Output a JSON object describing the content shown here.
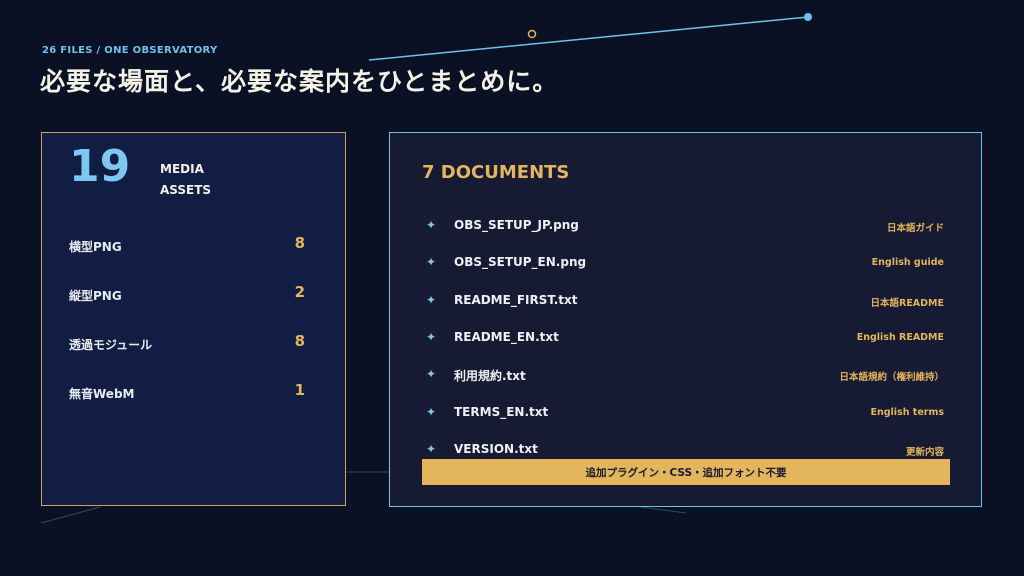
{
  "header": {
    "eyebrow": "26 FILES / ONE OBSERVATORY",
    "headline": "必要な場面と、必要な案内をひとまとめに。"
  },
  "media": {
    "count": "19",
    "label_line1": "MEDIA",
    "label_line2": "ASSETS",
    "items": [
      {
        "label": "横型PNG",
        "value": "8"
      },
      {
        "label": "縦型PNG",
        "value": "2"
      },
      {
        "label": "透過モジュール",
        "value": "8"
      },
      {
        "label": "無音WebM",
        "value": "1"
      }
    ]
  },
  "documents": {
    "title": "7 DOCUMENTS",
    "items": [
      {
        "file": "OBS_SETUP_JP.png",
        "desc": "日本語ガイド"
      },
      {
        "file": "OBS_SETUP_EN.png",
        "desc": "English guide"
      },
      {
        "file": "README_FIRST.txt",
        "desc": "日本語README"
      },
      {
        "file": "README_EN.txt",
        "desc": "English README"
      },
      {
        "file": "利用規約.txt",
        "desc": "日本語規約（権利維持）"
      },
      {
        "file": "TERMS_EN.txt",
        "desc": "English terms"
      },
      {
        "file": "VERSION.txt",
        "desc": "更新内容"
      }
    ],
    "bullet_icon": "four-point-star-icon",
    "banner": "追加プラグイン・CSS・追加フォント不要"
  },
  "colors": {
    "background": "#0b1124",
    "gold": "#e3b55d",
    "sky": "#6ec3ea",
    "media_card_bg": "#121d44",
    "docs_card_bg": "#161a33"
  }
}
